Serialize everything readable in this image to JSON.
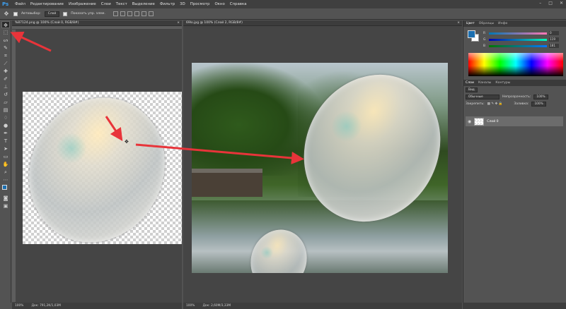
{
  "app": {
    "logo": "Ps"
  },
  "menubar": {
    "items": [
      "Файл",
      "Редактирование",
      "Изображение",
      "Слои",
      "Текст",
      "Выделение",
      "Фильтр",
      "3D",
      "Просмотр",
      "Окно",
      "Справка"
    ],
    "window_controls": [
      "–",
      "□",
      "✕"
    ]
  },
  "options_bar": {
    "auto_select_label": "Автовыбор:",
    "auto_select_value": "Слой",
    "show_transform_label": "Показать упр. элем."
  },
  "documents": [
    {
      "tab_title": "%87124.png @ 100% (Слой 0, RGB/8#)",
      "close": "×",
      "status_zoom": "100%",
      "status_doc": "Док: 791,2K/1,03M"
    },
    {
      "tab_title": "69lo.jpg @ 100% (Слой 2, RGB/8#)",
      "close": "×",
      "status_zoom": "100%",
      "status_doc": "Док: 2,60M/3,33M"
    }
  ],
  "color_panel": {
    "tabs": [
      "Цвет",
      "Образцы",
      "Инфо"
    ],
    "foreground": "#1c6fb0",
    "background": "#ffffff",
    "sliders": [
      {
        "label": "R",
        "value": "0"
      },
      {
        "label": "G",
        "value": "119"
      },
      {
        "label": "B",
        "value": "181"
      }
    ]
  },
  "layers_panel": {
    "tabs": [
      "Слои",
      "Каналы",
      "Контуры"
    ],
    "filter": "Вид",
    "blend_mode": "Обычные",
    "opacity_label": "Непрозрачность:",
    "opacity_value": "100%",
    "lock_label": "Закрепить:",
    "fill_label": "Заливка:",
    "fill_value": "100%",
    "layers": [
      {
        "name": "Слой 0",
        "visible": true
      }
    ]
  },
  "colors": {
    "annotation_arrow": "#e8343a",
    "accent": "#1c6fb0"
  }
}
